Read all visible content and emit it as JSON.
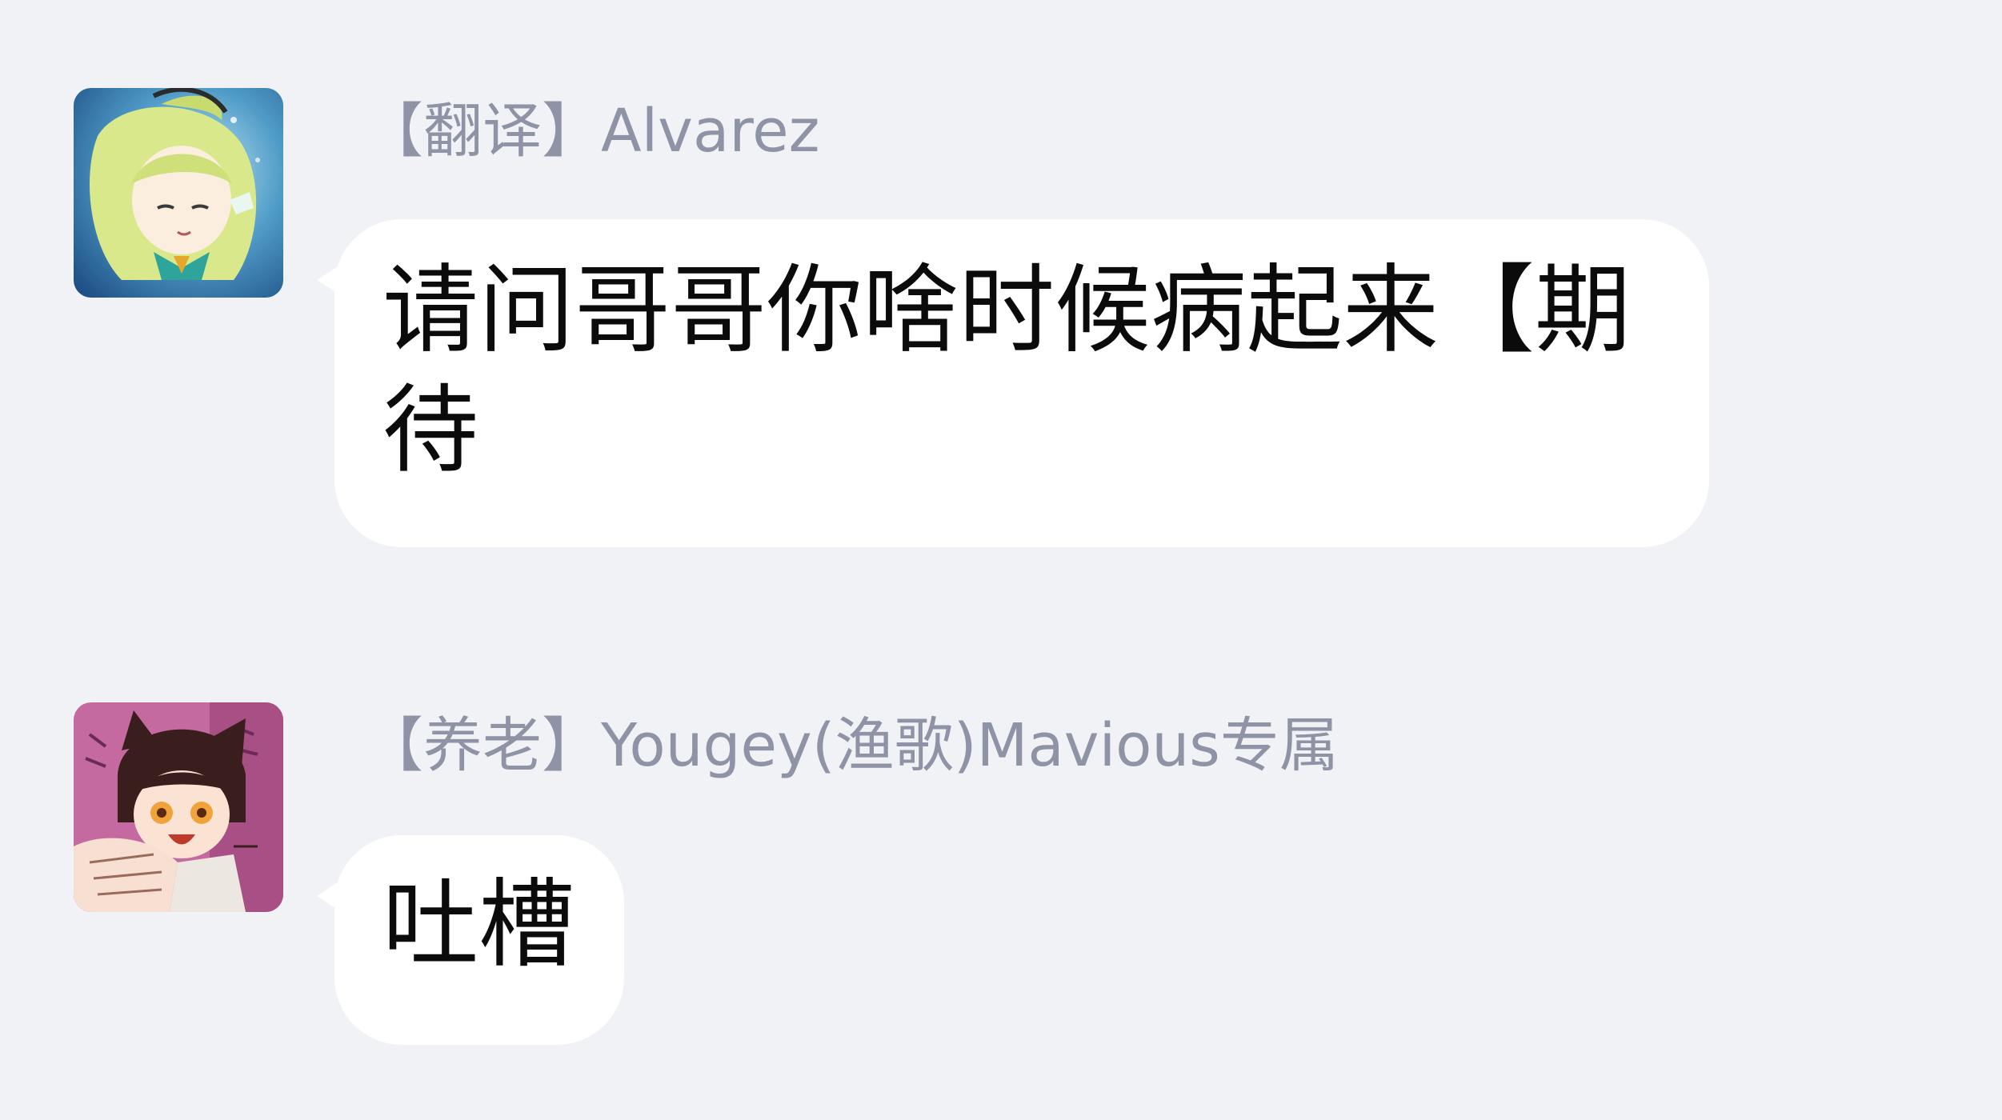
{
  "messages": [
    {
      "sender": "【翻译】Alvarez",
      "text": "请问哥哥你啥时候病起来【期待",
      "avatar_icon": "anime-girl-avatar-icon"
    },
    {
      "sender": "【养老】Yougey(渔歌)Mavious专属",
      "text": "吐槽",
      "avatar_icon": "anime-boy-avatar-icon"
    }
  ],
  "colors": {
    "background": "#f1f2f6",
    "bubble": "#ffffff",
    "sender_text": "#8e93a6",
    "message_text": "#0b0b0b"
  }
}
